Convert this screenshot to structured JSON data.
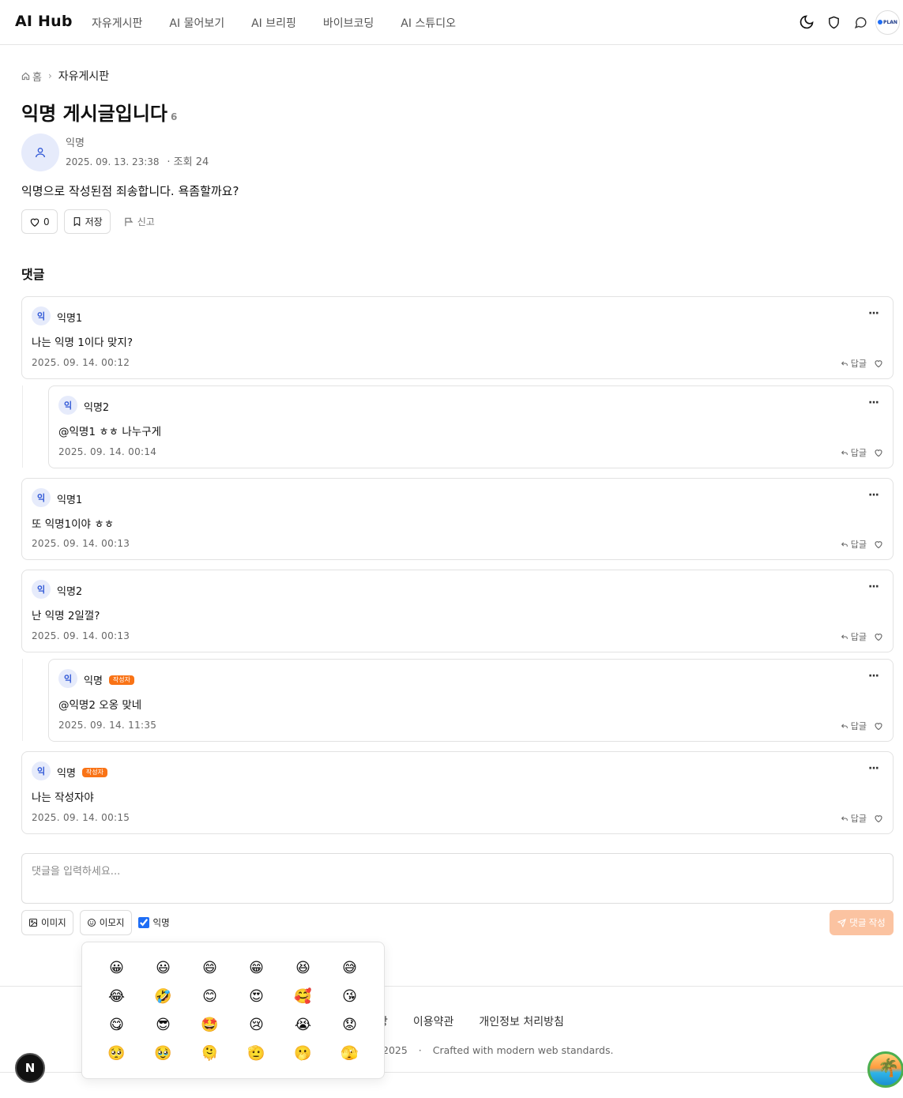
{
  "header": {
    "logo": "AI Hub",
    "nav": [
      "자유게시판",
      "AI 물어보기",
      "AI 브리핑",
      "바이브코딩",
      "AI 스튜디오"
    ],
    "plan_label": "PLAN"
  },
  "breadcrumb": {
    "home": "홈",
    "current": "자유게시판"
  },
  "post": {
    "title": "익명 게시글입니다",
    "comment_count": "6",
    "author": "익명",
    "date": "2025. 09. 13. 23:38",
    "views": "· 조회 24",
    "body": "익명으로 작성된점 죄송합니다. 욕좀할까요?",
    "like_count": "0",
    "save_label": "저장",
    "report_label": "신고"
  },
  "comments_title": "댓글",
  "comments": [
    {
      "avatar": "익",
      "name": "익명1",
      "text": "나는 익명 1이다 맞지?",
      "date": "2025. 09. 14. 00:12",
      "reply_label": "답글",
      "more": "···"
    },
    {
      "avatar": "익",
      "name": "익명2",
      "text": "@익명1 ㅎㅎ 나누구게",
      "date": "2025. 09. 14. 00:14",
      "reply_label": "답글",
      "more": "···"
    },
    {
      "avatar": "익",
      "name": "익명1",
      "text": "또 익명1이야 ㅎㅎ",
      "date": "2025. 09. 14. 00:13",
      "reply_label": "답글",
      "more": "···"
    },
    {
      "avatar": "익",
      "name": "익명2",
      "text": "난 익명 2일껄?",
      "date": "2025. 09. 14. 00:13",
      "reply_label": "답글",
      "more": "···"
    },
    {
      "avatar": "익",
      "name": "익명",
      "badge": "작성자",
      "text": "@익명2 오옹 맞네",
      "date": "2025. 09. 14. 11:35",
      "reply_label": "답글",
      "more": "···"
    },
    {
      "avatar": "익",
      "name": "익명",
      "badge": "작성자",
      "text": "나는 작성자야",
      "date": "2025. 09. 14. 00:15",
      "reply_label": "답글",
      "more": "···"
    }
  ],
  "editor": {
    "placeholder": "댓글을 입력하세요...",
    "image_label": "이미지",
    "emoji_label": "이모지",
    "anonymous_label": "익명",
    "submit_label": "댓글 작성"
  },
  "emoji_panel": {
    "emojis": [
      "😀",
      "😃",
      "😄",
      "😁",
      "😆",
      "😅",
      "😂",
      "🤣",
      "😊",
      "😍",
      "🥰",
      "😘",
      "😋",
      "😎",
      "🤩",
      "😢",
      "😭",
      "😟",
      "🥺",
      "🥹",
      "🫠",
      "🫡",
      "🫢",
      "🫣"
    ]
  },
  "footer": {
    "links": [
      "방",
      "이용약관",
      "개인정보 처리방침"
    ],
    "year": "2025",
    "crafted": "Crafted with modern web standards."
  },
  "floating": {
    "n_badge": "N"
  },
  "colors": {
    "accent_orange": "#f97316",
    "submit_disabled": "#fbc3a1",
    "avatar_bg": "#e6ebfb",
    "avatar_text": "#2f57d6"
  }
}
